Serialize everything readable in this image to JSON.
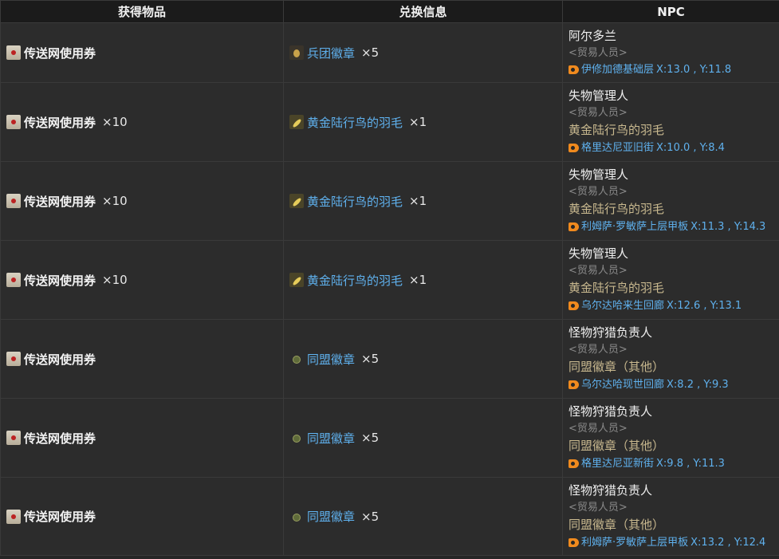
{
  "headers": {
    "col1": "获得物品",
    "col2": "兑换信息",
    "col3": "NPC"
  },
  "rows": [
    {
      "item": "传送网使用券",
      "item_qty": "",
      "exchange": "兵团徽章",
      "exchange_qty": "×5",
      "exchange_icon": "medal-icon",
      "npc": {
        "name": "阿尔多兰",
        "role": "<贸易人员>",
        "shop": "",
        "location": "伊修加德基础层",
        "coords": "X:13.0 , Y:11.8"
      }
    },
    {
      "item": "传送网使用券",
      "item_qty": "×10",
      "exchange": "黄金陆行鸟的羽毛",
      "exchange_qty": "×1",
      "exchange_icon": "feather-icon",
      "npc": {
        "name": "失物管理人",
        "role": "<贸易人员>",
        "shop": "黄金陆行鸟的羽毛",
        "location": "格里达尼亚旧街",
        "coords": "X:10.0 , Y:8.4"
      }
    },
    {
      "item": "传送网使用券",
      "item_qty": "×10",
      "exchange": "黄金陆行鸟的羽毛",
      "exchange_qty": "×1",
      "exchange_icon": "feather-icon",
      "npc": {
        "name": "失物管理人",
        "role": "<贸易人员>",
        "shop": "黄金陆行鸟的羽毛",
        "location": "利姆萨·罗敏萨上层甲板",
        "coords": "X:11.3 , Y:14.3"
      }
    },
    {
      "item": "传送网使用券",
      "item_qty": "×10",
      "exchange": "黄金陆行鸟的羽毛",
      "exchange_qty": "×1",
      "exchange_icon": "feather-icon",
      "npc": {
        "name": "失物管理人",
        "role": "<贸易人员>",
        "shop": "黄金陆行鸟的羽毛",
        "location": "乌尔达哈来生回廊",
        "coords": "X:12.6 , Y:13.1"
      }
    },
    {
      "item": "传送网使用券",
      "item_qty": "",
      "exchange": "同盟徽章",
      "exchange_qty": "×5",
      "exchange_icon": "seal-icon",
      "npc": {
        "name": "怪物狩猎负责人",
        "role": "<贸易人员>",
        "shop": "同盟徽章（其他）",
        "location": "乌尔达哈现世回廊",
        "coords": "X:8.2 , Y:9.3"
      }
    },
    {
      "item": "传送网使用券",
      "item_qty": "",
      "exchange": "同盟徽章",
      "exchange_qty": "×5",
      "exchange_icon": "seal-icon",
      "npc": {
        "name": "怪物狩猎负责人",
        "role": "<贸易人员>",
        "shop": "同盟徽章（其他）",
        "location": "格里达尼亚新街",
        "coords": "X:9.8 , Y:11.3"
      }
    },
    {
      "item": "传送网使用券",
      "item_qty": "",
      "exchange": "同盟徽章",
      "exchange_qty": "×5",
      "exchange_icon": "seal-icon",
      "npc": {
        "name": "怪物狩猎负责人",
        "role": "<贸易人员>",
        "shop": "同盟徽章（其他）",
        "location": "利姆萨·罗敏萨上层甲板",
        "coords": "X:13.2 , Y:12.4"
      }
    }
  ]
}
